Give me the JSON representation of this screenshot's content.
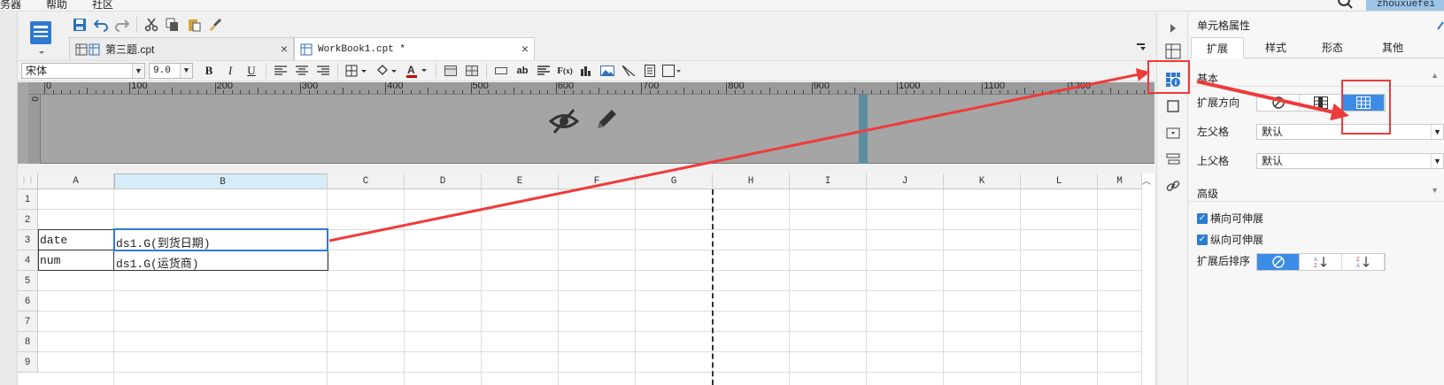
{
  "menu": {
    "items": [
      "务器",
      "帮助",
      "社区"
    ],
    "user": "zhouxuefei"
  },
  "tabs": [
    {
      "label": "第三题.cpt",
      "close": "×",
      "active": false
    },
    {
      "label": "WorkBook1.cpt *",
      "close": "×",
      "active": true
    }
  ],
  "format": {
    "font": "宋体",
    "size": "9.0"
  },
  "ruler": {
    "labels": [
      "0",
      "100",
      "200",
      "300",
      "400",
      "500",
      "600",
      "700",
      "800",
      "900",
      "1000",
      "1100",
      "1200"
    ],
    "vlabel": "0"
  },
  "grid": {
    "columns": [
      "A",
      "B",
      "C",
      "D",
      "E",
      "F",
      "G",
      "H",
      "I",
      "J",
      "K",
      "L",
      "M"
    ],
    "rows": [
      "1",
      "2",
      "3",
      "4",
      "5",
      "6",
      "7",
      "8",
      "9"
    ],
    "cells": {
      "a3": "date",
      "b3": "ds1.G(到货日期)",
      "a4": "num",
      "b4": "ds1.G(运货商)"
    },
    "selected_column": "B"
  },
  "panel": {
    "title": "单元格属性",
    "tabs": [
      "扩展",
      "样式",
      "形态",
      "其他"
    ],
    "active_tab": "扩展",
    "basic": "基本",
    "expand_direction_label": "扩展方向",
    "left_parent_label": "左父格",
    "left_parent_value": "默认",
    "top_parent_label": "上父格",
    "top_parent_value": "默认",
    "advanced": "高级",
    "horizontal_expand": "横向可伸展",
    "vertical_expand": "纵向可伸展",
    "sort_after_expand_label": "扩展后排序"
  },
  "colors": {
    "accent": "#3c8ce7",
    "annotation": "#ef3a3a",
    "selection": "#2d7ad6"
  }
}
